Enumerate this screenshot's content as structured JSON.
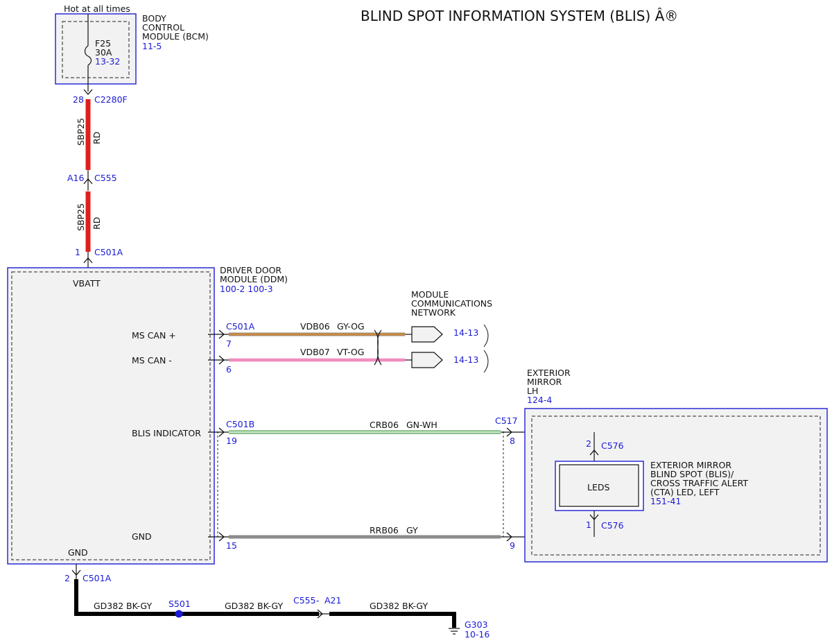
{
  "title": "BLIND SPOT INFORMATION SYSTEM (BLIS) Â®",
  "colors": {
    "ref_blue": "#1a1ad6",
    "module_border": "#2b2bd9",
    "module_fill": "#f2f2f2",
    "wire_red": "#e0201c",
    "wire_gy_og": "#b38a5a",
    "wire_vt_og": "#f0a0c0",
    "wire_gn_wh": "#2e9e2e",
    "wire_gy": "#8c8c8c",
    "wire_bk": "#000000"
  },
  "hot_label": "Hot at all times",
  "bcm": {
    "name_lines": [
      "BODY",
      "CONTROL",
      "MODULE (BCM)"
    ],
    "ref": "11-5",
    "fuse_name": "F25",
    "fuse_rating": "30A",
    "fuse_ref": "13-32"
  },
  "connectors": {
    "c2280f": {
      "pin": "28",
      "name": "C2280F"
    },
    "c555": {
      "pin": "A16",
      "name": "C555"
    },
    "c501a_top": {
      "pin": "1",
      "name": "C501A"
    },
    "c501a_can": {
      "name": "C501A"
    },
    "c501b": {
      "name": "C501B"
    },
    "c517": {
      "name": "C517"
    },
    "c576_top": {
      "pin": "2",
      "name": "C576"
    },
    "c576_bot": {
      "pin": "1",
      "name": "C576"
    },
    "c501a_gnd": {
      "pin": "2",
      "name": "C501A"
    }
  },
  "wire_labels": {
    "sbp25_a": {
      "circuit": "SBP25",
      "color": "RD"
    },
    "sbp25_b": {
      "circuit": "SBP25",
      "color": "RD"
    }
  },
  "ddm": {
    "name_lines": [
      "DRIVER DOOR",
      "MODULE (DDM)"
    ],
    "refs": "100-2  100-3",
    "vbatt": "VBATT",
    "gnd": "GND",
    "pins": {
      "ms_can_plus": {
        "label": "MS CAN +",
        "pin": "7"
      },
      "ms_can_minus": {
        "label": "MS CAN -",
        "pin": "6"
      },
      "blis_indicator": {
        "label": "BLIS INDICATOR",
        "pin": "19"
      },
      "gnd": {
        "label": "GND",
        "pin": "15"
      }
    }
  },
  "wires": {
    "vdb06": {
      "circuit": "VDB06",
      "color": "GY-OG"
    },
    "vdb07": {
      "circuit": "VDB07",
      "color": "VT-OG"
    },
    "crb06": {
      "circuit": "CRB06",
      "color": "GN-WH"
    },
    "rrb06": {
      "circuit": "RRB06",
      "color": "GY"
    },
    "gd382_a": {
      "circuit": "GD382",
      "color": "BK-GY"
    },
    "gd382_b": {
      "circuit": "GD382",
      "color": "BK-GY"
    },
    "gd382_c": {
      "circuit": "GD382",
      "color": "BK-GY"
    }
  },
  "network": {
    "name_lines": [
      "MODULE",
      "COMMUNICATIONS",
      "NETWORK"
    ],
    "ref_plus": "14-13",
    "ref_minus": "14-13"
  },
  "mirror": {
    "name_lines": [
      "EXTERIOR",
      "MIRROR",
      "LH"
    ],
    "ref": "124-4",
    "pin_blis": "8",
    "pin_gnd": "9",
    "leds_label": "LEDS",
    "component_lines": [
      "EXTERIOR MIRROR",
      "BLIND SPOT (BLIS)/",
      "CROSS TRAFFIC ALERT",
      "(CTA) LED, LEFT"
    ],
    "component_ref": "151-41"
  },
  "ground": {
    "splice": "S501",
    "inline_connector": "C555",
    "inline_sep": "-",
    "inline_pin": "A21",
    "point": "G303",
    "ref": "10-16"
  }
}
